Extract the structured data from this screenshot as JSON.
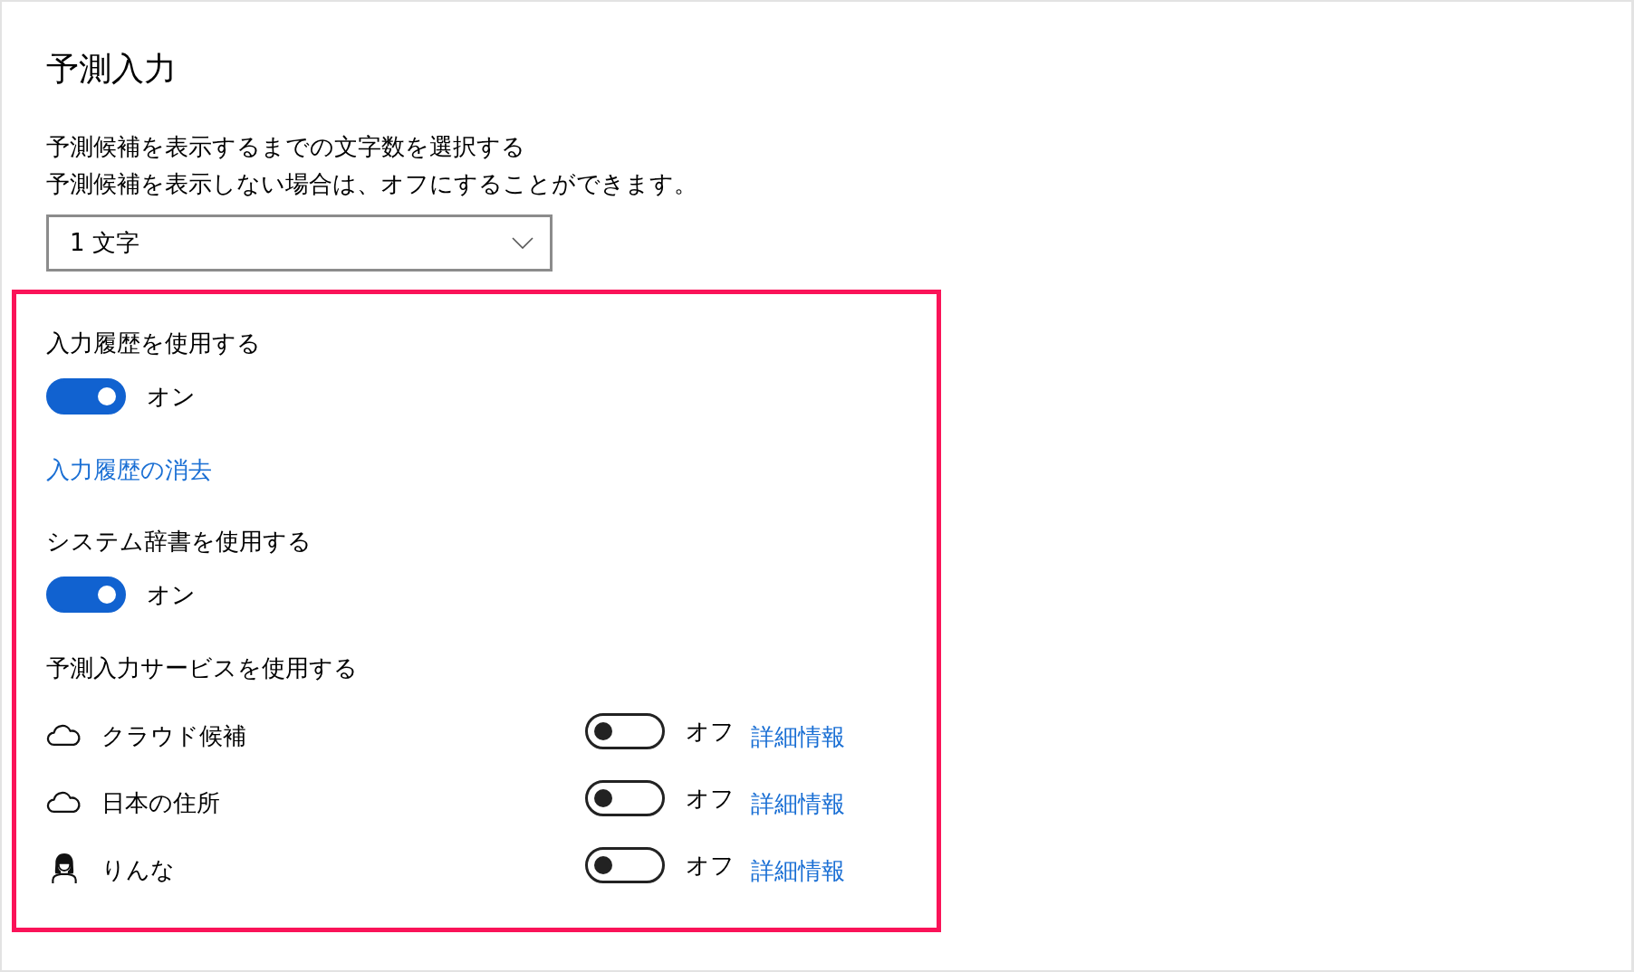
{
  "section": {
    "title": "予測入力",
    "description": [
      "予測候補を表示するまでの文字数を選択する",
      "予測候補を表示しない場合は、オフにすることができます。"
    ],
    "dropdown": {
      "value": "1 文字"
    }
  },
  "settings_group": {
    "highlighted": true,
    "items": [
      {
        "kind": "toggle",
        "label": "入力履歴を使用する",
        "on": true,
        "state_text": "オン"
      },
      {
        "kind": "link",
        "label": "入力履歴の消去"
      },
      {
        "kind": "toggle",
        "label": "システム辞書を使用する",
        "on": true,
        "state_text": "オン"
      },
      {
        "kind": "service_list",
        "label": "予測入力サービスを使用する",
        "services": [
          {
            "kind": "cloud",
            "name": "クラウド候補",
            "on": false,
            "state_text": "オフ",
            "link": "詳細情報"
          },
          {
            "kind": "cloud",
            "name": "日本の住所",
            "on": false,
            "state_text": "オフ",
            "link": "詳細情報"
          },
          {
            "kind": "character",
            "name": "りんな",
            "on": false,
            "state_text": "オフ",
            "link": "詳細情報"
          }
        ]
      }
    ]
  }
}
